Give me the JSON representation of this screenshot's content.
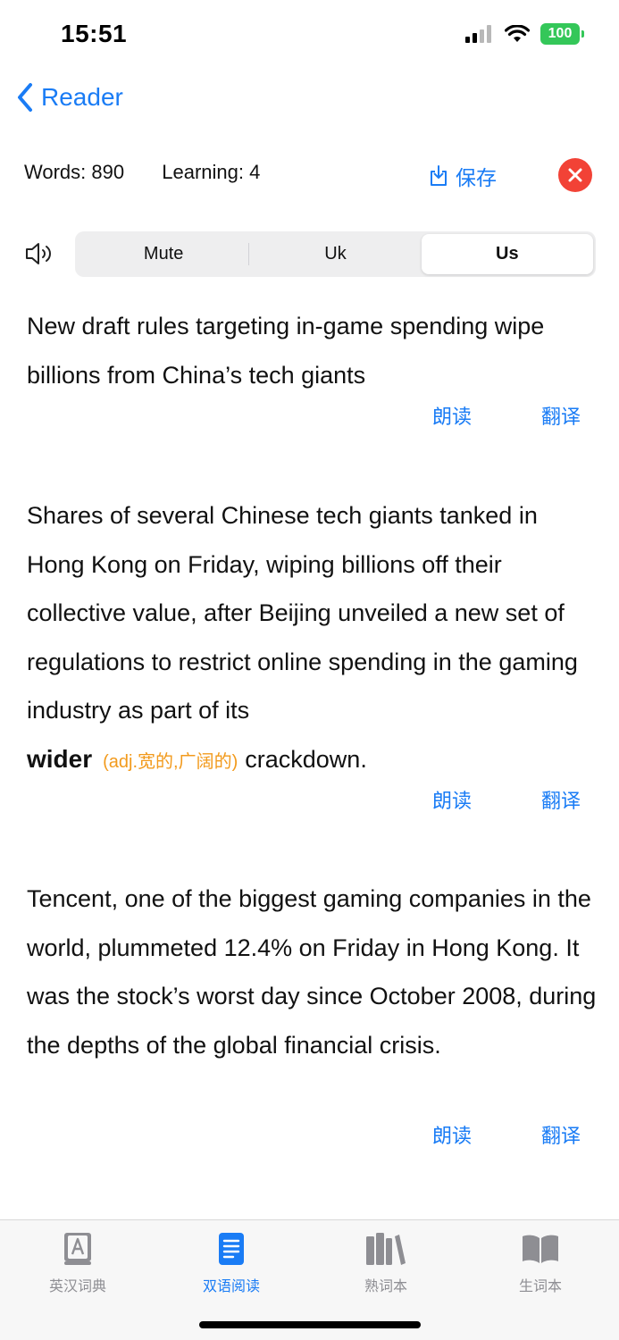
{
  "status": {
    "time": "15:51",
    "battery": "100"
  },
  "nav": {
    "back_label": "Reader"
  },
  "stats": {
    "words": "Words: 890",
    "learning": "Learning: 4"
  },
  "toolbar": {
    "save_label": "保存"
  },
  "voice": {
    "options": [
      "Mute",
      "Uk",
      "Us"
    ],
    "selected": "Us"
  },
  "paragraphs": [
    {
      "text": "New draft rules targeting in-game spending wipe billions from China’s tech giants"
    },
    {
      "text": "Shares of several Chinese tech giants tanked in Hong Kong on Friday, wiping billions off their collective value, after Beijing unveiled a new set of regulations to restrict online spending in the gaming industry as part of its",
      "highlight_word": "wider",
      "highlight_gloss": "(adj.宽的,广阔的)",
      "tail": "crackdown."
    },
    {
      "text": "Tencent, one of the biggest gaming companies in the world, plummeted 12.4% on Friday in Hong Kong. It was the stock’s worst day since October 2008, during the depths of the global financial crisis."
    }
  ],
  "actions": {
    "read_label": "朗读",
    "translate_label": "翻译"
  },
  "tabs": [
    {
      "label": "英汉词典",
      "icon": "dictionary-icon"
    },
    {
      "label": "双语阅读",
      "icon": "reading-icon",
      "active": true
    },
    {
      "label": "熟词本",
      "icon": "library-icon"
    },
    {
      "label": "生词本",
      "icon": "book-icon"
    }
  ],
  "colors": {
    "accent": "#1a7cf5",
    "gloss": "#f29a1c",
    "close": "#f24236",
    "battery": "#34c759"
  }
}
